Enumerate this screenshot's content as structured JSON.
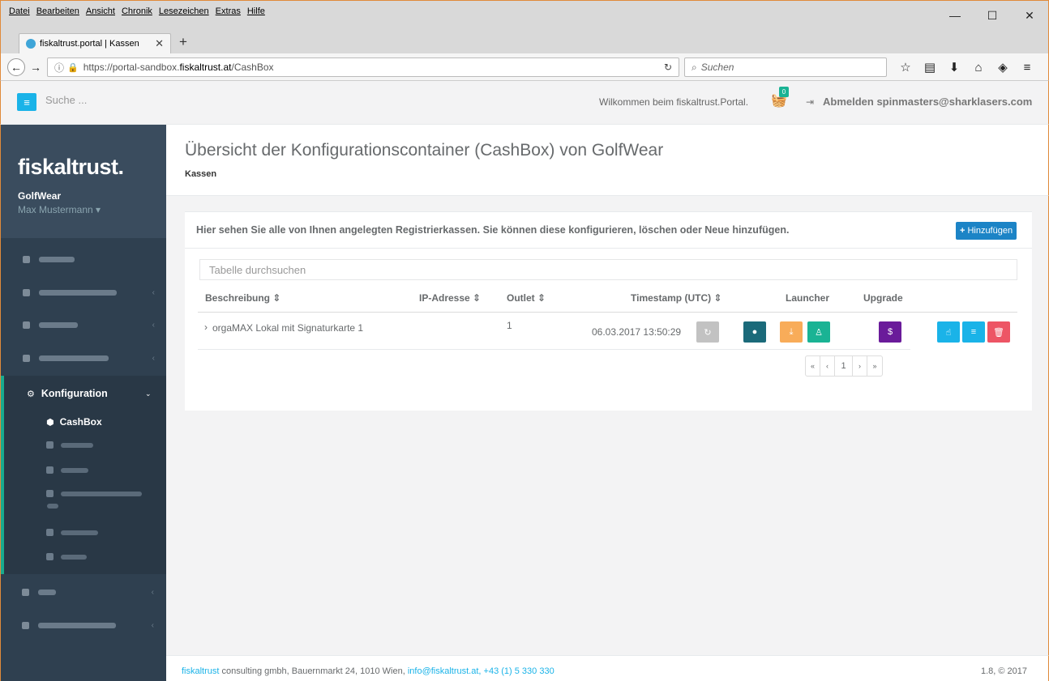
{
  "browser": {
    "menus": [
      "Datei",
      "Bearbeiten",
      "Ansicht",
      "Chronik",
      "Lesezeichen",
      "Extras",
      "Hilfe"
    ],
    "tab_title": "fiskaltrust.portal | Kassen",
    "url_prefix": "https://portal-sandbox.",
    "url_domain": "fiskaltrust.at",
    "url_suffix": "/CashBox",
    "search_placeholder": "Suchen",
    "window_controls": [
      "—",
      "☐",
      "✕"
    ]
  },
  "header": {
    "search_placeholder": "Suche ...",
    "welcome": "Wilkommen beim fiskaltrust.Portal.",
    "cart_count": "0",
    "logout": "Abmelden spinmasters@sharklasers.com"
  },
  "sidebar": {
    "logo": "fiskaltrust.",
    "company": "GolfWear",
    "user": "Max Mustermann ▾",
    "section_label": "Konfiguration",
    "active_sub": "CashBox"
  },
  "page": {
    "title": "Übersicht der Konfigurationscontainer (CashBox) von GolfWear",
    "breadcrumb": "Kassen"
  },
  "panel": {
    "intro": "Hier sehen Sie alle von Ihnen angelegten Registrierkassen. Sie können diese konfigurieren, löschen oder Neue hinzufügen.",
    "add_button": "Hinzufügen",
    "table_search_placeholder": "Tabelle durchsuchen",
    "columns": {
      "description": "Beschreibung ⇕",
      "ip": "IP-Adresse ⇕",
      "outlet": "Outlet ⇕",
      "timestamp": "Timestamp (UTC) ⇕",
      "launcher": "Launcher",
      "upgrade": "Upgrade"
    },
    "rows": [
      {
        "description": "orgaMAX Lokal mit Signaturkarte 1",
        "ip": "",
        "outlet": "1",
        "timestamp": "06.03.2017 13:50:29"
      }
    ],
    "pager": {
      "first": "«",
      "prev": "‹",
      "page": "1",
      "next": "›",
      "last": "»"
    }
  },
  "footer": {
    "brand": "fiskaltrust",
    "address": " consulting gmbh, Bauernmarkt 24, 1010 Wien, ",
    "email": "info@fiskaltrust.at",
    "phone": ", +43 (1) 5 330 330",
    "version": "1.8, © 2017"
  },
  "colors": {
    "sidebar_bg": "#2f4050",
    "accent_teal": "#19aa8d",
    "accent_blue": "#1c84c6",
    "accent_cyan": "#1ab3e8",
    "danger": "#ed5565",
    "warning": "#f8ac59",
    "purple": "#6a1b9a",
    "darkteal": "#1b6a7a"
  }
}
